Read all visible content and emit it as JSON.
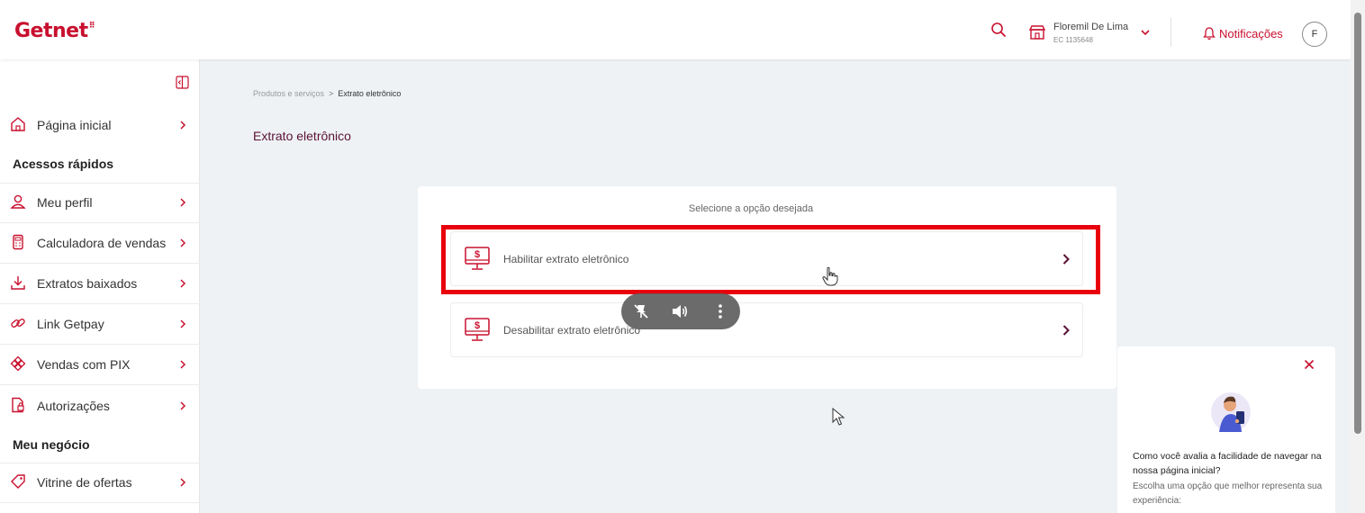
{
  "header": {
    "logo": "Getnet",
    "logo_mark": "⠿",
    "search_icon": "search-icon",
    "store_name": "Floremil De Lima",
    "store_ec": "EC 1135648",
    "notifications_label": "Notificações",
    "avatar_initial": "F"
  },
  "sidebar": {
    "home": {
      "label": "Página inicial",
      "icon": "home-icon"
    },
    "section_quick_access": "Acessos rápidos",
    "quick_items": [
      {
        "label": "Meu perfil",
        "icon": "user-icon"
      },
      {
        "label": "Calculadora de vendas",
        "icon": "calculator-icon"
      },
      {
        "label": "Extratos baixados",
        "icon": "download-icon"
      },
      {
        "label": "Link Getpay",
        "icon": "link-icon"
      },
      {
        "label": "Vendas com PIX",
        "icon": "pix-icon"
      },
      {
        "label": "Autorizações",
        "icon": "document-lock-icon"
      }
    ],
    "section_business": "Meu negócio",
    "business_items": [
      {
        "label": "Vitrine de ofertas",
        "icon": "tag-icon"
      }
    ]
  },
  "main": {
    "breadcrumb": [
      "Produtos e serviços",
      "Extrato eletrônico"
    ],
    "breadcrumb_separator": ">",
    "title": "Extrato eletrônico",
    "instruction": "Selecione a opção desejada",
    "options": [
      {
        "label": "Habilitar extrato eletrônico",
        "icon": "monitor-dollar-icon"
      },
      {
        "label": "Desabilitar extrato eletrônico",
        "icon": "monitor-dollar-icon"
      }
    ]
  },
  "survey": {
    "question": "Como você avalia a facilidade de navegar na nossa página inicial?",
    "subtitle": "Escolha uma opção que melhor representa sua experiência:"
  },
  "colors": {
    "brand": "#c8102e",
    "title": "#5b1235",
    "highlight": "#e8000c",
    "background": "#eef2f5"
  }
}
